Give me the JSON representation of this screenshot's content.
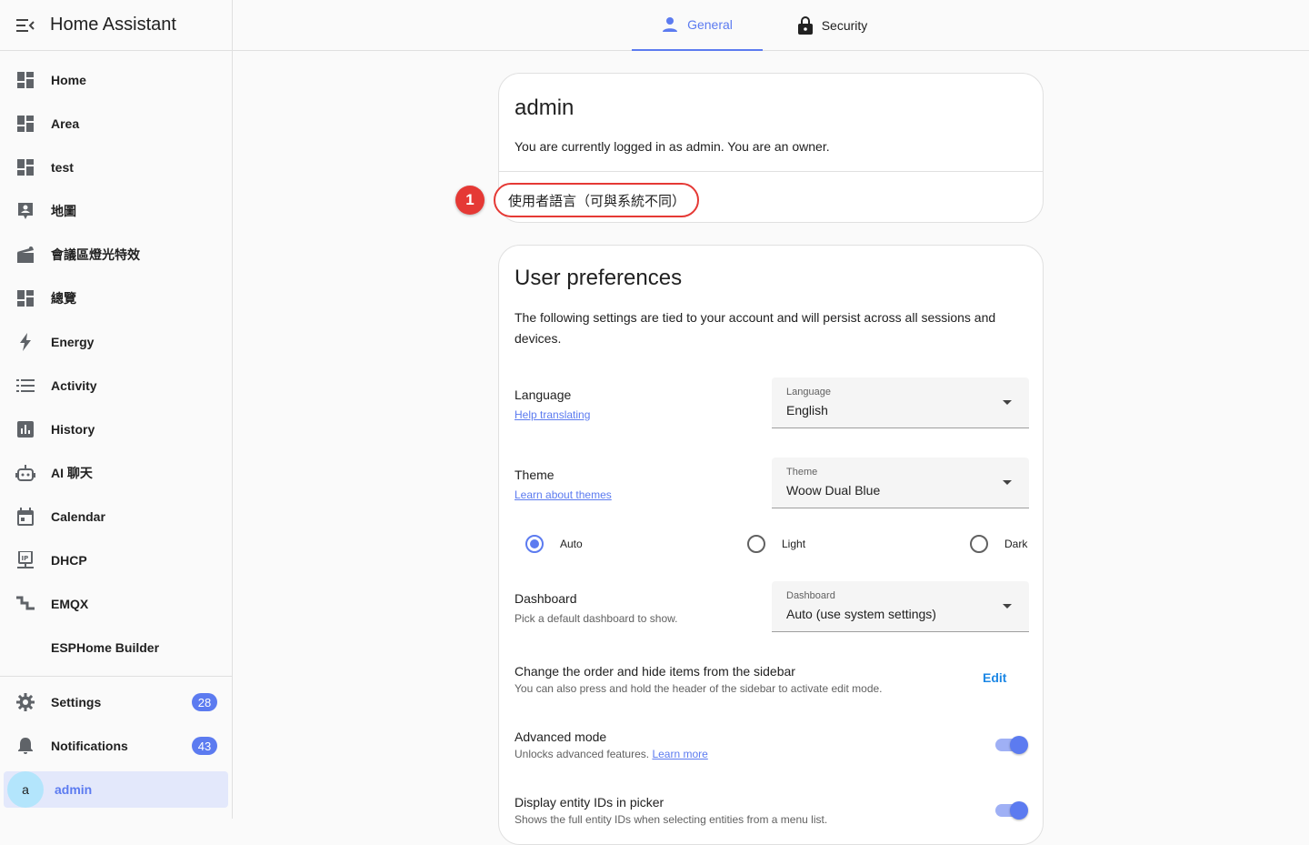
{
  "app": {
    "title": "Home Assistant"
  },
  "sidebar": {
    "items": [
      {
        "label": "Home",
        "icon": "dashboard-icon"
      },
      {
        "label": "Area",
        "icon": "dashboard-icon"
      },
      {
        "label": "test",
        "icon": "dashboard-icon"
      },
      {
        "label": "地圖",
        "icon": "map-account-icon"
      },
      {
        "label": "會議區燈光特效",
        "icon": "movie-clapper-icon"
      },
      {
        "label": "總覽",
        "icon": "dashboard-icon"
      },
      {
        "label": "Energy",
        "icon": "lightning-bolt-icon"
      },
      {
        "label": "Activity",
        "icon": "list-icon"
      },
      {
        "label": "History",
        "icon": "chart-box-icon"
      },
      {
        "label": "AI 聊天",
        "icon": "robot-icon"
      },
      {
        "label": "Calendar",
        "icon": "calendar-icon"
      },
      {
        "label": "DHCP",
        "icon": "ip-network-icon"
      },
      {
        "label": "EMQX",
        "icon": "stairs-icon"
      },
      {
        "label": "ESPHome Builder",
        "icon": ""
      }
    ],
    "settings": {
      "label": "Settings",
      "badge": "28"
    },
    "notifications": {
      "label": "Notifications",
      "badge": "43"
    },
    "user": {
      "label": "admin",
      "avatar": "a"
    }
  },
  "tabs": {
    "general": "General",
    "security": "Security"
  },
  "profile": {
    "name": "admin",
    "status": "You are currently logged in as admin. You are an owner.",
    "callout_number": "1",
    "callout_text": "使用者語言（可與系統不同）"
  },
  "prefs": {
    "title": "User preferences",
    "description": "The following settings are tied to your account and will persist across all sessions and devices.",
    "language": {
      "label": "Language",
      "link": "Help translating",
      "select_label": "Language",
      "value": "English"
    },
    "theme": {
      "label": "Theme",
      "link": "Learn about themes",
      "select_label": "Theme",
      "value": "Woow Dual Blue",
      "modes": [
        "Auto",
        "Light",
        "Dark"
      ],
      "selected_mode": "Auto"
    },
    "dashboard": {
      "label": "Dashboard",
      "sub": "Pick a default dashboard to show.",
      "select_label": "Dashboard",
      "value": "Auto (use system settings)"
    },
    "sidebar_order": {
      "label": "Change the order and hide items from the sidebar",
      "sub": "You can also press and hold the header of the sidebar to activate edit mode.",
      "button": "Edit"
    },
    "advanced": {
      "label": "Advanced mode",
      "sub": "Unlocks advanced features.",
      "link": "Learn more",
      "enabled": true
    },
    "entity_ids": {
      "label": "Display entity IDs in picker",
      "sub": "Shows the full entity IDs when selecting entities from a menu list.",
      "enabled": true
    }
  },
  "colors": {
    "accent": "#5c7bf0",
    "callout": "#e53935",
    "link": "#1e88e5"
  }
}
